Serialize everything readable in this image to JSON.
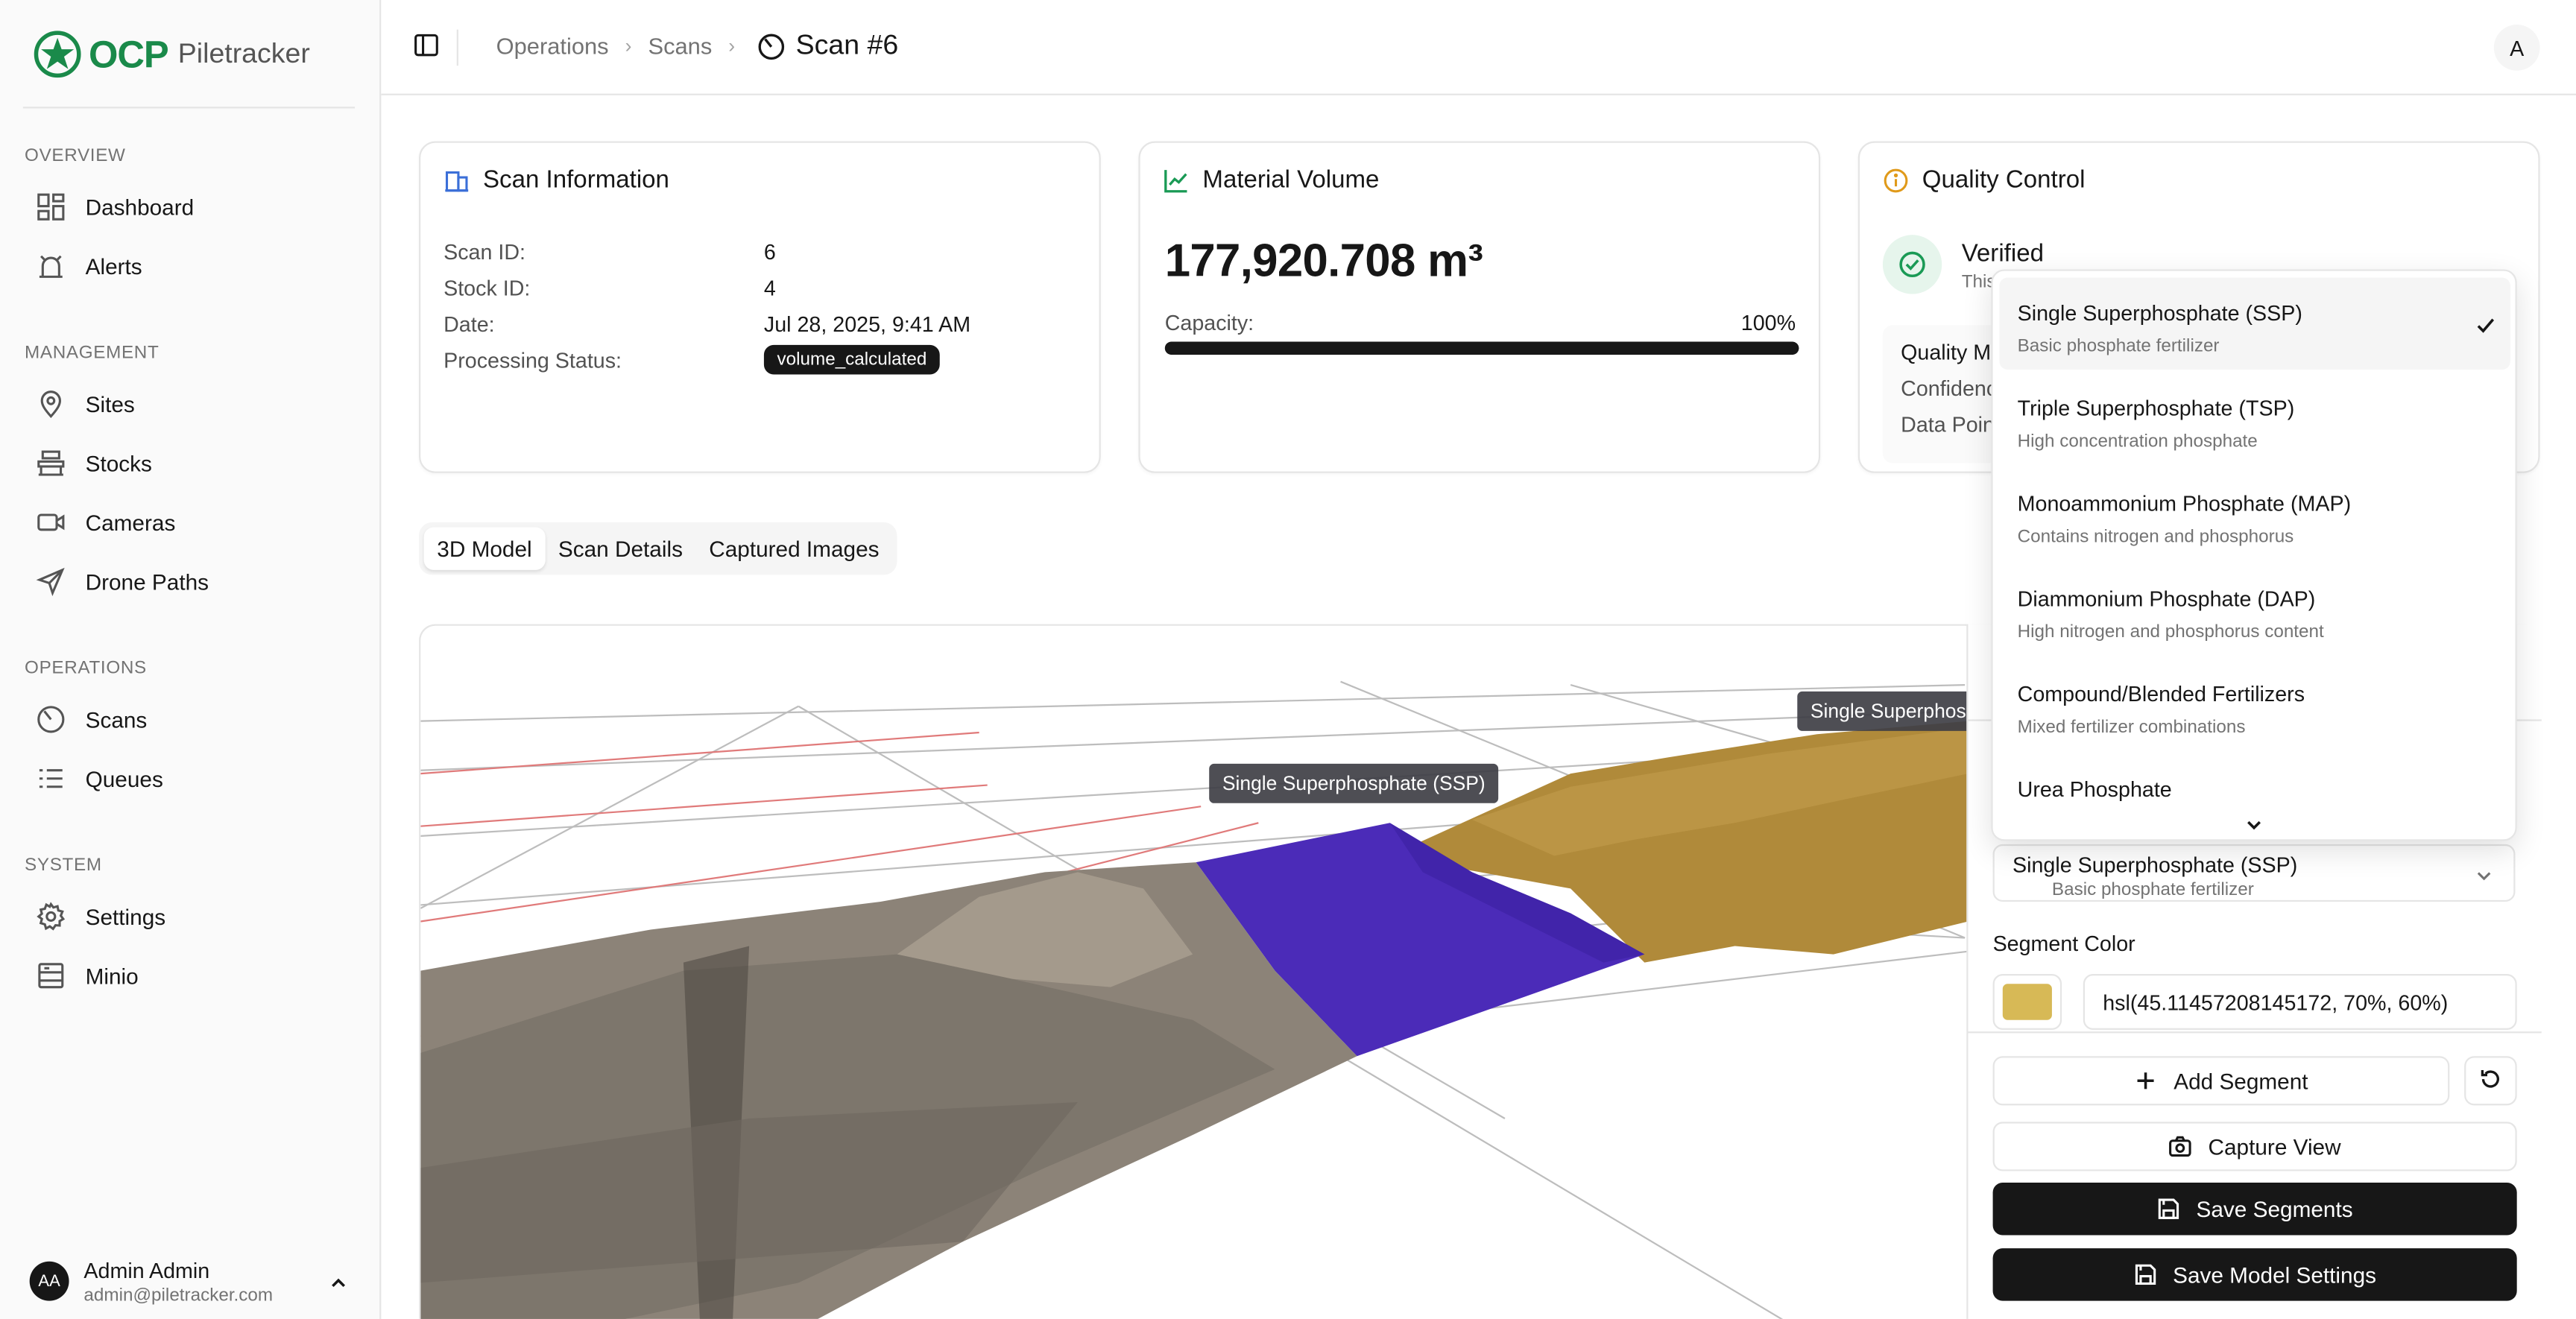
{
  "app": {
    "brand": "OCP",
    "product": "Piletracker"
  },
  "sidebar": {
    "sections": [
      {
        "title": "OVERVIEW",
        "items": [
          {
            "label": "Dashboard",
            "icon": "dashboard-icon"
          },
          {
            "label": "Alerts",
            "icon": "alarm-icon"
          }
        ]
      },
      {
        "title": "MANAGEMENT",
        "items": [
          {
            "label": "Sites",
            "icon": "map-pin-icon"
          },
          {
            "label": "Stocks",
            "icon": "warehouse-icon"
          },
          {
            "label": "Cameras",
            "icon": "video-icon"
          },
          {
            "label": "Drone Paths",
            "icon": "plane-icon"
          }
        ]
      },
      {
        "title": "OPERATIONS",
        "items": [
          {
            "label": "Scans",
            "icon": "scan-icon"
          },
          {
            "label": "Queues",
            "icon": "list-icon"
          }
        ]
      },
      {
        "title": "SYSTEM",
        "items": [
          {
            "label": "Settings",
            "icon": "gear-icon"
          },
          {
            "label": "Minio",
            "icon": "storage-icon"
          }
        ]
      }
    ],
    "user": {
      "initials": "AA",
      "name": "Admin Admin",
      "email": "admin@piletracker.com"
    }
  },
  "header": {
    "breadcrumbs": [
      "Operations",
      "Scans"
    ],
    "current": "Scan #6",
    "avatar": "A"
  },
  "scan_info": {
    "title": "Scan Information",
    "rows": [
      {
        "label": "Scan ID:",
        "value": "6"
      },
      {
        "label": "Stock ID:",
        "value": "4"
      },
      {
        "label": "Date:",
        "value": "Jul 28, 2025, 9:41 AM"
      },
      {
        "label": "Processing Status:",
        "value": "volume_calculated"
      }
    ]
  },
  "volume": {
    "title": "Material Volume",
    "value": "177,920.708 m³",
    "capacity_label": "Capacity:",
    "capacity_value": "100%",
    "capacity_fraction": 1.0
  },
  "quality": {
    "title": "Quality Control",
    "status": "Verified",
    "status_sub": "This",
    "metrics_title": "Quality M",
    "confidence_label": "Confidenc",
    "datapoints_label": "Data Poin"
  },
  "tabs": [
    "3D Model",
    "Scan Details",
    "Captured Images"
  ],
  "model": {
    "labels": [
      "Single Superphosphate (SSP)",
      "Single Superphosp"
    ]
  },
  "dropdown": {
    "options": [
      {
        "title": "Single Superphosphate (SSP)",
        "subtitle": "Basic phosphate fertilizer",
        "selected": true
      },
      {
        "title": "Triple Superphosphate (TSP)",
        "subtitle": "High concentration phosphate",
        "selected": false
      },
      {
        "title": "Monoammonium Phosphate (MAP)",
        "subtitle": "Contains nitrogen and phosphorus",
        "selected": false
      },
      {
        "title": "Diammonium Phosphate (DAP)",
        "subtitle": "High nitrogen and phosphorus content",
        "selected": false
      },
      {
        "title": "Compound/Blended Fertilizers",
        "subtitle": "Mixed fertilizer combinations",
        "selected": false
      },
      {
        "title": "Urea Phosphate",
        "subtitle": "",
        "selected": false
      }
    ]
  },
  "panel": {
    "selected_title": "Single Superphosphate (SSP)",
    "selected_sub": "Basic phosphate fertilizer",
    "segment_color_label": "Segment Color",
    "segment_color_value": "hsl(45.11457208145172, 70%, 60%)",
    "swatch_color": "#d7b956",
    "add_segment": "Add Segment",
    "capture_view": "Capture View",
    "save_segments": "Save Segments",
    "save_model_settings": "Save Model Settings"
  },
  "colors": {
    "brand_green": "#1a8a4a",
    "segment_purple": "#4b2bb8",
    "segment_gold": "#b08a3a"
  }
}
